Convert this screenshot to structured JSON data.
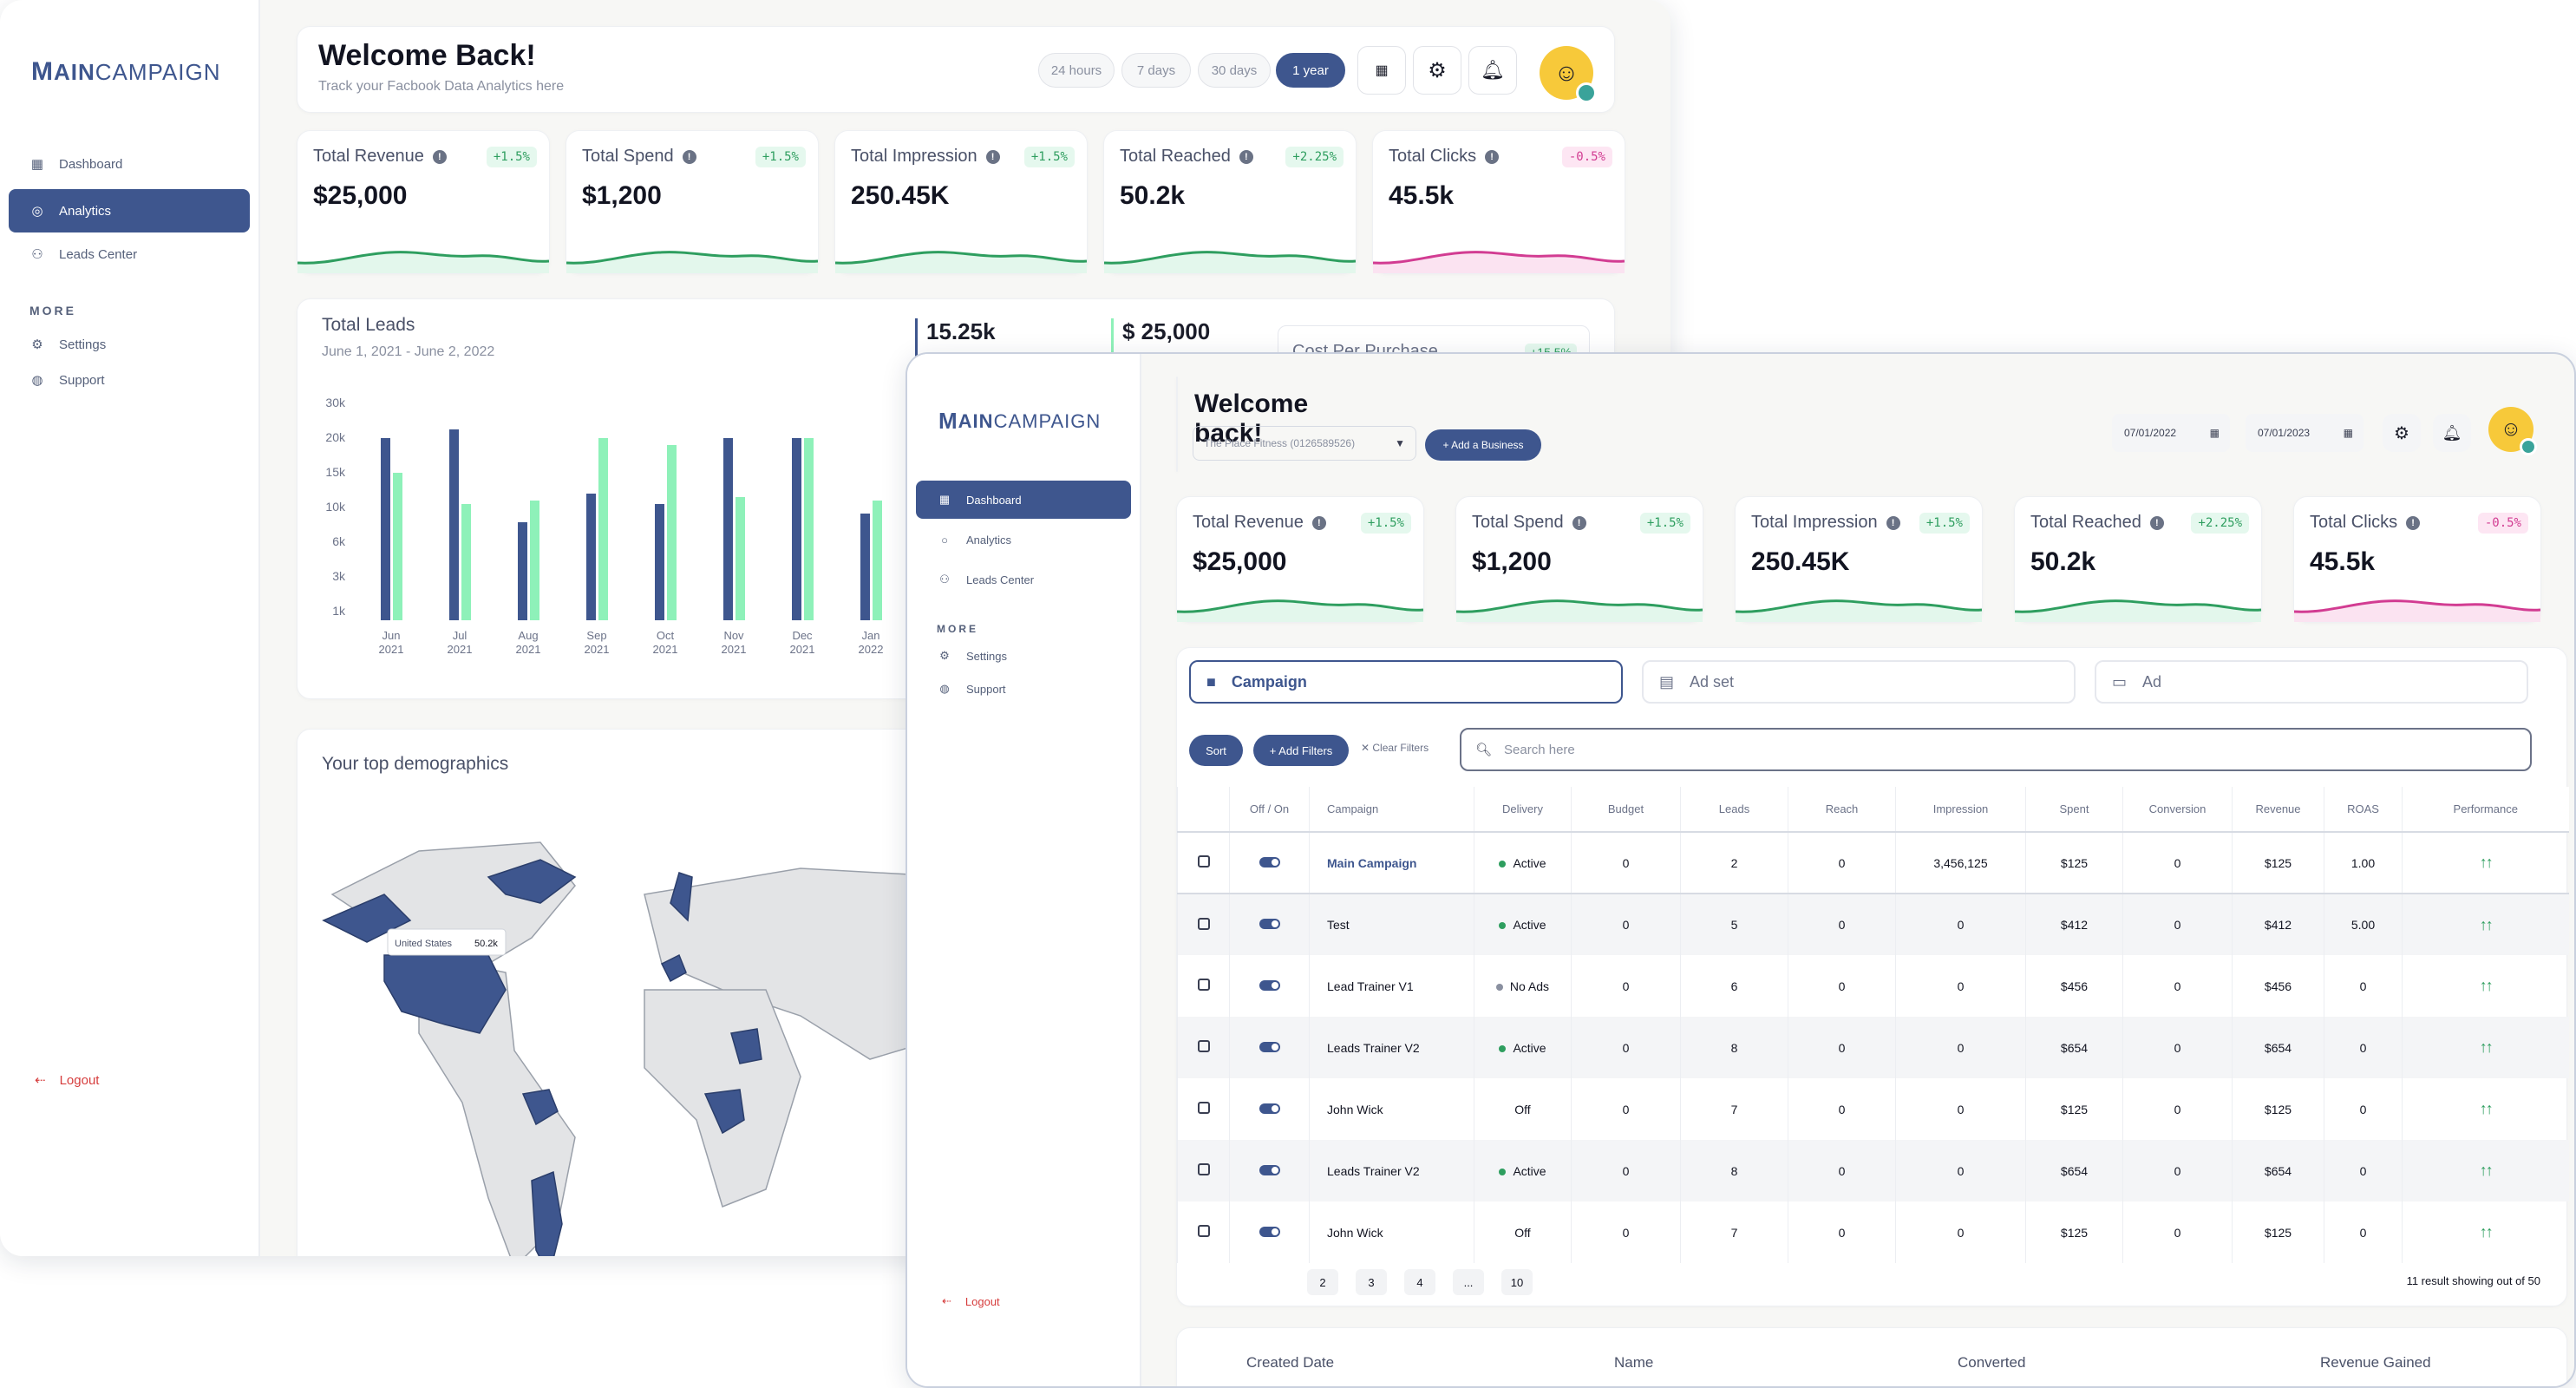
{
  "brand": {
    "prefix": "M",
    "bold": "AIN",
    "rest": "CAMPAIGN",
    "color": "#3e568e"
  },
  "colors": {
    "accent": "#3e568e",
    "bar_primary": "#3e568e",
    "bar_secondary": "#8ef1b9",
    "up": "#2e9e5f",
    "down": "#d23c92",
    "logout": "#d63d3d"
  },
  "back_window": {
    "sidebar": {
      "items": [
        {
          "label": "Dashboard",
          "icon": "grid-icon"
        },
        {
          "label": "Analytics",
          "icon": "analytics-icon"
        },
        {
          "label": "Leads Center",
          "icon": "people-icon"
        }
      ],
      "more_label": "MORE",
      "more_items": [
        {
          "label": "Settings",
          "icon": "settings-icon"
        },
        {
          "label": "Support",
          "icon": "support-icon"
        }
      ],
      "logout": "Logout"
    },
    "header": {
      "title": "Welcome Back!",
      "subtitle": "Track your Facbook Data Analytics here",
      "ranges": [
        "24 hours",
        "7 days",
        "30 days",
        "1 year"
      ],
      "active_range": "1 year"
    },
    "kpis": [
      {
        "label": "Total Revenue",
        "value": "$25,000",
        "change": "+1.5%",
        "trend": "up"
      },
      {
        "label": "Total Spend",
        "value": "$1,200",
        "change": "+1.5%",
        "trend": "up"
      },
      {
        "label": "Total Impression",
        "value": "250.45K",
        "change": "+1.5%",
        "trend": "up"
      },
      {
        "label": "Total Reached",
        "value": "50.2k",
        "change": "+2.25%",
        "trend": "up"
      },
      {
        "label": "Total Clicks",
        "value": "45.5k",
        "change": "-0.5%",
        "trend": "down"
      }
    ],
    "total_leads": {
      "title": "Total Leads",
      "date_range": "June 1, 2021 - June 2, 2022",
      "stat1": "15.25k",
      "stat2": "$ 25,000",
      "cost_label": "Cost Per Purchase",
      "cost_change": "+15.5%"
    },
    "demographics": {
      "title": "Your top demographics",
      "tooltip_label": "United States",
      "tooltip_value": "50.2k"
    }
  },
  "chart_data": {
    "type": "bar",
    "categories": [
      "Jun 2021",
      "Jul 2021",
      "Aug 2021",
      "Sep 2021",
      "Oct 2021",
      "Nov 2021",
      "Dec 2021",
      "Jan 2022"
    ],
    "x_tick_month": [
      "Jun",
      "Jul",
      "Aug",
      "Sep",
      "Oct",
      "Nov",
      "Dec",
      "Jan"
    ],
    "x_tick_year": [
      "2021",
      "2021",
      "2021",
      "2021",
      "2021",
      "2021",
      "2021",
      "2022"
    ],
    "y_ticks": [
      "30k",
      "20k",
      "15k",
      "10k",
      "6k",
      "3k",
      "1k"
    ],
    "ylim": [
      0,
      30000
    ],
    "series": [
      {
        "values": [
          20000,
          22500,
          8300,
          12000,
          10500,
          20000,
          20000,
          9300
        ]
      },
      {
        "values": [
          15000,
          10500,
          11000,
          20000,
          19000,
          11500,
          20000,
          11000
        ]
      }
    ]
  },
  "front_window": {
    "sidebar": {
      "items": [
        {
          "label": "Dashboard",
          "icon": "grid-icon"
        },
        {
          "label": "Analytics",
          "icon": "analytics-icon"
        },
        {
          "label": "Leads Center",
          "icon": "people-icon"
        }
      ],
      "more_label": "MORE",
      "more_items": [
        {
          "label": "Settings",
          "icon": "settings-icon"
        },
        {
          "label": "Support",
          "icon": "support-icon"
        }
      ],
      "logout": "Logout"
    },
    "header": {
      "title": "Welcome back!",
      "business_select": "The Place Fitness (0126589526)",
      "add_business": "+ Add a Business",
      "date_from": "07/01/2022",
      "date_to": "07/01/2023"
    },
    "kpis": [
      {
        "label": "Total Revenue",
        "value": "$25,000",
        "change": "+1.5%",
        "trend": "up"
      },
      {
        "label": "Total Spend",
        "value": "$1,200",
        "change": "+1.5%",
        "trend": "up"
      },
      {
        "label": "Total Impression",
        "value": "250.45K",
        "change": "+1.5%",
        "trend": "up"
      },
      {
        "label": "Total Reached",
        "value": "50.2k",
        "change": "+2.25%",
        "trend": "up"
      },
      {
        "label": "Total Clicks",
        "value": "45.5k",
        "change": "-0.5%",
        "trend": "down"
      }
    ],
    "level_tabs": [
      "Campaign",
      "Ad set",
      "Ad"
    ],
    "toolbar": {
      "sort": "Sort",
      "add_filters": "+ Add Filters",
      "clear_filters": "Clear Filters",
      "search_placeholder": "Search here"
    },
    "table": {
      "columns": [
        "Off / On",
        "Campaign",
        "Delivery",
        "Budget",
        "Leads",
        "Reach",
        "Impression",
        "Spent",
        "Conversion",
        "Revenue",
        "ROAS",
        "Performance"
      ],
      "rows": [
        {
          "campaign": "Main Campaign",
          "delivery": "Active",
          "budget": "0",
          "leads": "2",
          "reach": "0",
          "impression": "3,456,125",
          "spent": "$125",
          "conversion": "0",
          "revenue": "$125",
          "roas": "1.00"
        },
        {
          "campaign": "Test",
          "delivery": "Active",
          "budget": "0",
          "leads": "5",
          "reach": "0",
          "impression": "0",
          "spent": "$412",
          "conversion": "0",
          "revenue": "$412",
          "roas": "5.00"
        },
        {
          "campaign": "Lead Trainer V1",
          "delivery": "No Ads",
          "budget": "0",
          "leads": "6",
          "reach": "0",
          "impression": "0",
          "spent": "$456",
          "conversion": "0",
          "revenue": "$456",
          "roas": "0"
        },
        {
          "campaign": "Leads Trainer V2",
          "delivery": "Active",
          "budget": "0",
          "leads": "8",
          "reach": "0",
          "impression": "0",
          "spent": "$654",
          "conversion": "0",
          "revenue": "$654",
          "roas": "0"
        },
        {
          "campaign": "John Wick",
          "delivery": "Off",
          "budget": "0",
          "leads": "7",
          "reach": "0",
          "impression": "0",
          "spent": "$125",
          "conversion": "0",
          "revenue": "$125",
          "roas": "0"
        },
        {
          "campaign": "Leads Trainer V2",
          "delivery": "Active",
          "budget": "0",
          "leads": "8",
          "reach": "0",
          "impression": "0",
          "spent": "$654",
          "conversion": "0",
          "revenue": "$654",
          "roas": "0"
        },
        {
          "campaign": "John Wick",
          "delivery": "Off",
          "budget": "0",
          "leads": "7",
          "reach": "0",
          "impression": "0",
          "spent": "$125",
          "conversion": "0",
          "revenue": "$125",
          "roas": "0"
        }
      ]
    },
    "pagination": {
      "pages": [
        "2",
        "3",
        "4",
        "...",
        "10"
      ],
      "summary": "11 result showing out of 50"
    },
    "bottom_columns": [
      "Created Date",
      "Name",
      "Converted",
      "Revenue Gained"
    ]
  }
}
